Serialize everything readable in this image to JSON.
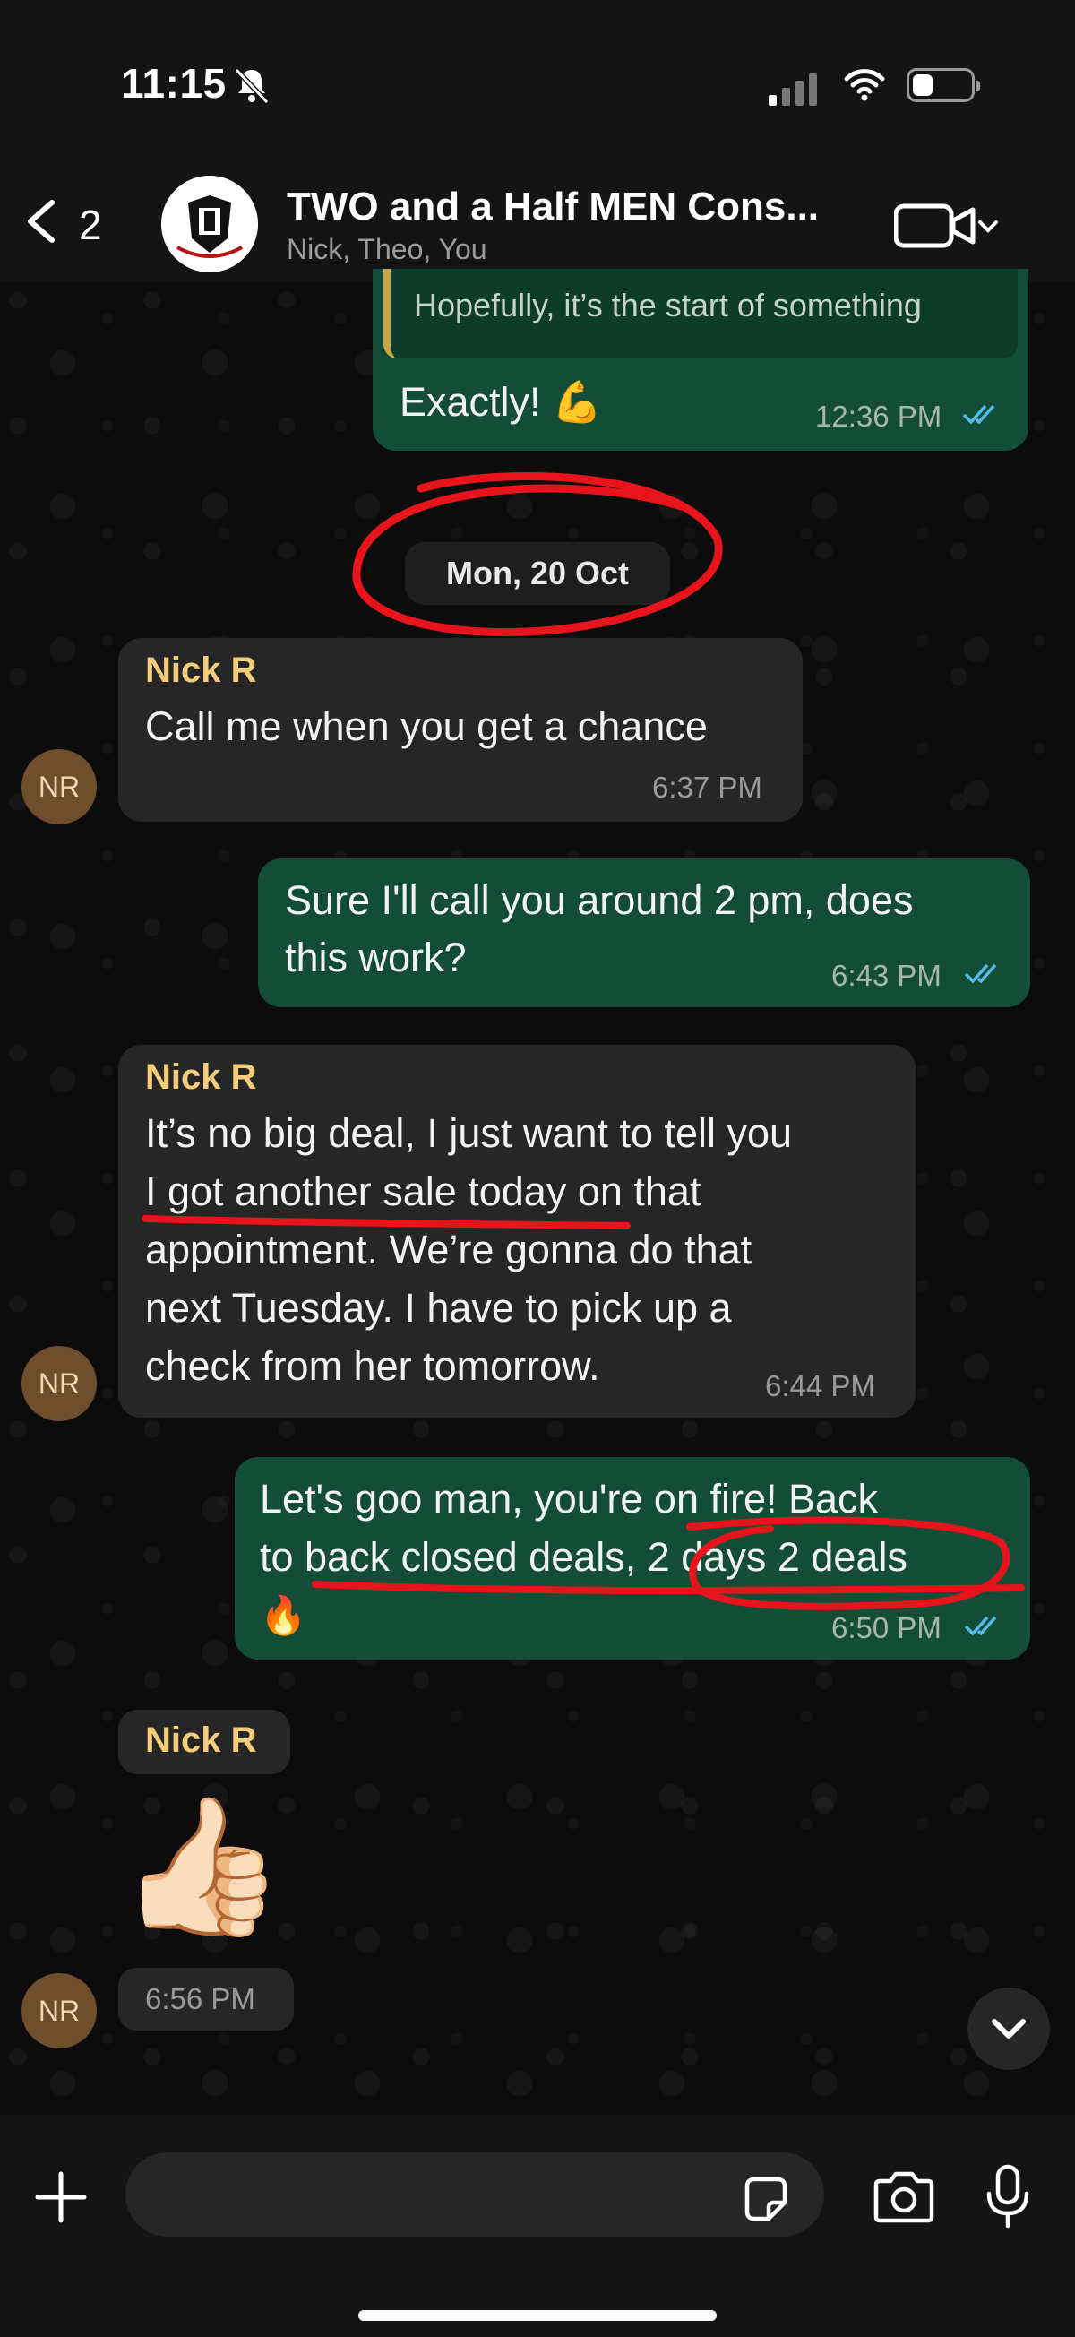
{
  "status_bar": {
    "time": "11:15",
    "battery_level": 0.35
  },
  "header": {
    "back_count": "2",
    "title": "TWO and a Half MEN Cons...",
    "members": "Nick, Theo, You"
  },
  "date_separator": "Mon, 20 Oct",
  "messages": [
    {
      "direction": "out",
      "quoted_text": "Hopefully, it’s the start of something",
      "text": "Exactly! 💪",
      "time": "12:36 PM",
      "read": true
    },
    {
      "direction": "in",
      "sender": "Nick R",
      "lines": [
        "Call me when you get a chance"
      ],
      "time": "6:37 PM",
      "avatar": "NR"
    },
    {
      "direction": "out",
      "lines": [
        "Sure I'll call you around 2 pm, does",
        "this work?"
      ],
      "time": "6:43 PM",
      "read": true
    },
    {
      "direction": "in",
      "sender": "Nick R",
      "lines": [
        "It’s no big deal, I just want to tell you",
        "I got another sale today on that",
        "appointment. We’re gonna do that",
        "next Tuesday. I have to pick up a",
        "check from her tomorrow."
      ],
      "time": "6:44 PM",
      "avatar": "NR"
    },
    {
      "direction": "out",
      "lines": [
        "Let's goo man, you're on fire! Back",
        "to back closed deals, 2 days 2 deals",
        "🔥"
      ],
      "time": "6:50 PM",
      "read": true
    },
    {
      "direction": "in",
      "sender": "Nick R",
      "emoji": "👍🏻",
      "time": "6:56 PM",
      "avatar": "NR"
    }
  ],
  "composer": {
    "placeholder": ""
  },
  "colors": {
    "outgoing_bubble": "#134d37",
    "incoming_bubble": "#262626",
    "sender_name": "#f5cd7a",
    "read_ticks": "#53bdeb",
    "annotation": "#e8141c"
  }
}
